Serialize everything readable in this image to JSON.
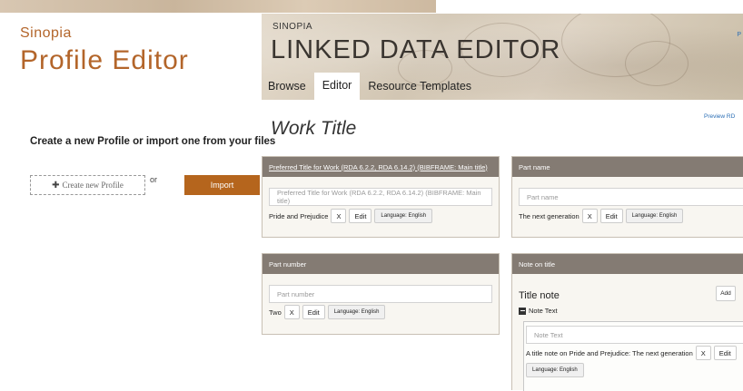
{
  "profile_editor": {
    "brand_small": "Sinopia",
    "brand_big": "Profile Editor",
    "prompt": "Create a new Profile or import one from your files",
    "create_button": "Create new Profile",
    "create_icon": "plus-icon",
    "or_text": "or",
    "import_button": "Import"
  },
  "header": {
    "sinopia": "SINOPIA",
    "title": "LINKED DATA EDITOR",
    "edge_link": "P",
    "tabs": [
      {
        "label": "Browse",
        "active": false
      },
      {
        "label": "Editor",
        "active": true
      },
      {
        "label": "Resource Templates",
        "active": false
      }
    ]
  },
  "page": {
    "title": "Work Title",
    "preview_link": "Preview RD"
  },
  "panels": {
    "preferred_title": {
      "header": "Preferred Title for Work (RDA 6.2.2, RDA 6.14.2) (BIBFRAME: Main title)",
      "placeholder": "Preferred Title for Work (RDA 6.2.2, RDA 6.14.2) (BIBFRAME: Main title)",
      "value": "Pride and Prejudice",
      "remove_label": "X",
      "edit_label": "Edit",
      "language_label": "Language: English"
    },
    "part_name": {
      "header": "Part name",
      "placeholder": "Part name",
      "value": "The next generation",
      "remove_label": "X",
      "edit_label": "Edit",
      "language_label": "Language: English"
    },
    "part_number": {
      "header": "Part number",
      "placeholder": "Part number",
      "value": "Two",
      "remove_label": "X",
      "edit_label": "Edit",
      "language_label": "Language: English"
    },
    "note_on_title": {
      "header": "Note on title",
      "subtitle": "Title note",
      "add_label": "Add",
      "note_label": "Note Text",
      "placeholder": "Note Text",
      "value": "A title note on Pride and Prejudice: The next generation",
      "remove_label": "X",
      "edit_label": "Edit",
      "language_label": "Language: English"
    }
  },
  "colors": {
    "brand_orange": "#b3652a",
    "import_button": "#b5651d",
    "panel_header": "#847b73",
    "link_blue": "#2a6db4"
  }
}
